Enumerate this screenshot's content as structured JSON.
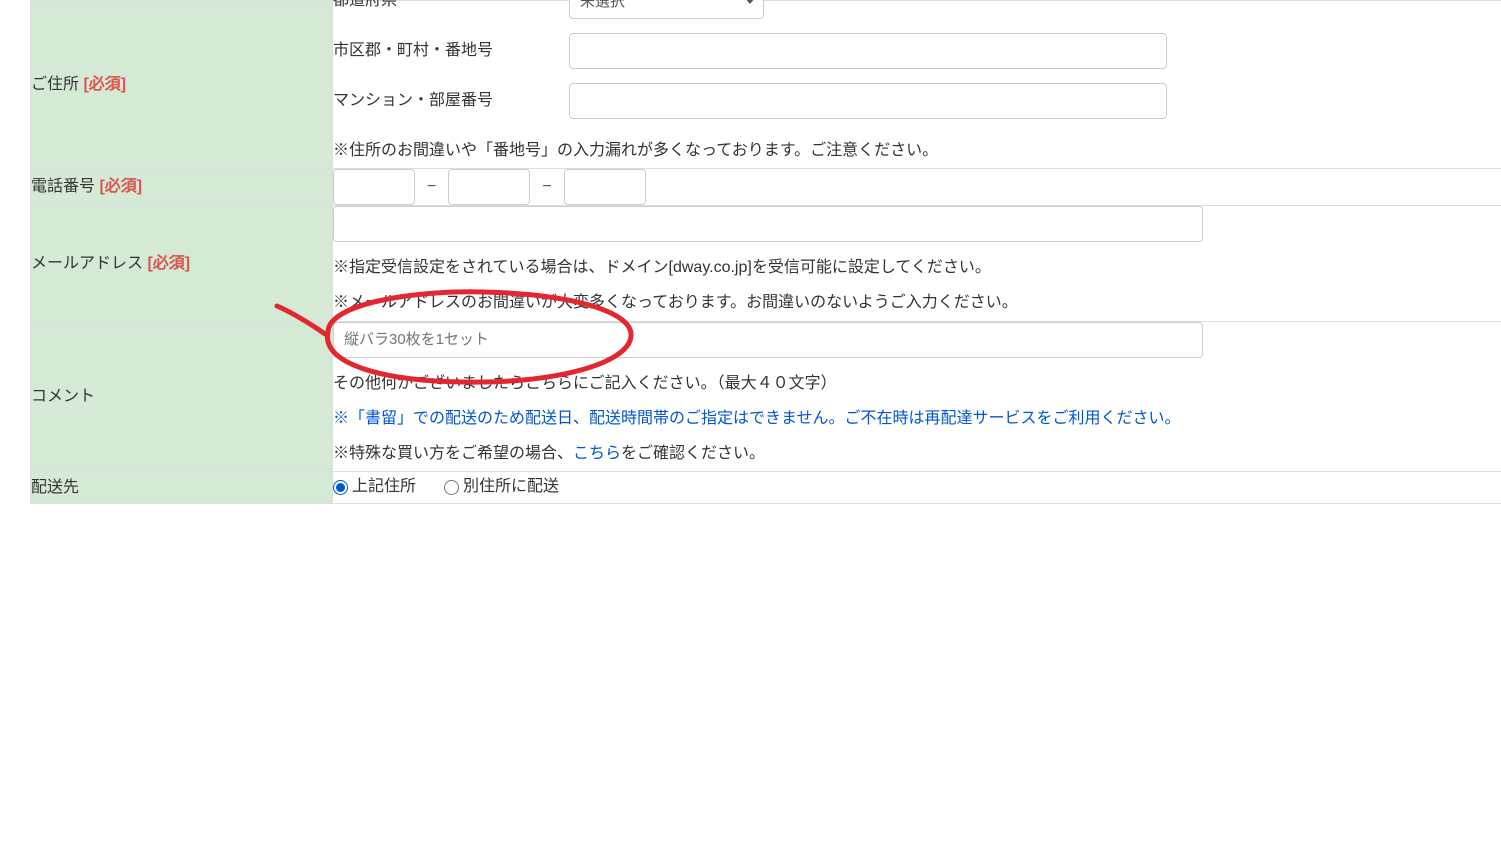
{
  "rows": {
    "address": {
      "label": "ご住所",
      "required": "[必須]",
      "prefecture_label": "都道府県",
      "prefecture_placeholder": "未選択",
      "city_label": "市区郡・町村・番地号",
      "building_label": "マンション・部屋番号",
      "note": "※住所のお間違いや「番地号」の入力漏れが多くなっております。ご注意ください。"
    },
    "phone": {
      "label": "電話番号",
      "required": "[必須]",
      "dash": "−"
    },
    "email": {
      "label": "メールアドレス",
      "required": "[必須]",
      "note1": "※指定受信設定をされている場合は、ドメイン[dway.co.jp]を受信可能に設定してください。",
      "note2": "※メールアドレスのお間違いが大変多くなっております。お間違いのないようご入力ください。"
    },
    "comment": {
      "label": "コメント",
      "placeholder": "縦バラ30枚を1セット",
      "note1": "その他何かございましたらこちらにご記入ください。（最大４０文字）",
      "note2_prefix": "※「書留」での配送のため配送日、配送時間帯のご指定はできません。ご不在時は",
      "note2_link": "再配達サービス",
      "note2_suffix": "をご利用ください。",
      "note3_prefix": "※特殊な買い方をご希望の場合、",
      "note3_link": "こちら",
      "note3_suffix": "をご確認ください。"
    },
    "delivery": {
      "label": "配送先",
      "opt_same": "上記住所",
      "opt_other": "別住所に配送"
    }
  }
}
